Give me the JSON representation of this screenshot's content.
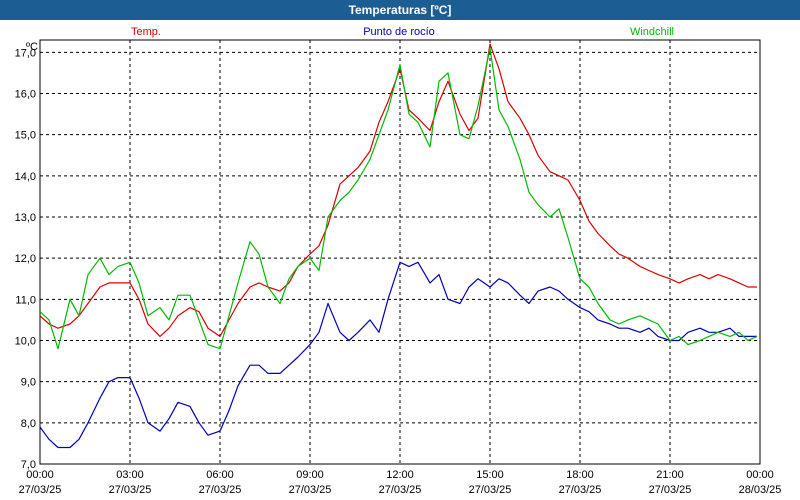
{
  "window": {
    "title": "Temperaturas [ºC]"
  },
  "chart_data": {
    "type": "line",
    "title": "Temperaturas [ºC]",
    "ylabel": "ºC",
    "ylim": [
      7.0,
      17.3
    ],
    "xlim": [
      0,
      24
    ],
    "grid": true,
    "legend_position": "top",
    "y_ticks": [
      "17,0",
      "16,0",
      "15,0",
      "14,0",
      "13,0",
      "12,0",
      "11,0",
      "10,0",
      "9,0",
      "8,0",
      "7,0"
    ],
    "y_tick_values": [
      17,
      16,
      15,
      14,
      13,
      12,
      11,
      10,
      9,
      8,
      7
    ],
    "x_ticks": [
      {
        "x": 0,
        "time": "00:00",
        "date": "27/03/25"
      },
      {
        "x": 3,
        "time": "03:00",
        "date": "27/03/25"
      },
      {
        "x": 6,
        "time": "06:00",
        "date": "27/03/25"
      },
      {
        "x": 9,
        "time": "09:00",
        "date": "27/03/25"
      },
      {
        "x": 12,
        "time": "12:00",
        "date": "27/03/25"
      },
      {
        "x": 15,
        "time": "15:00",
        "date": "27/03/25"
      },
      {
        "x": 18,
        "time": "18:00",
        "date": "27/03/25"
      },
      {
        "x": 21,
        "time": "21:00",
        "date": "27/03/25"
      },
      {
        "x": 24,
        "time": "00:00",
        "date": "28/03/25"
      }
    ],
    "series": [
      {
        "name": "Temp.",
        "color": "#dd0000",
        "x": [
          0,
          0.3,
          0.6,
          1.0,
          1.3,
          1.6,
          2.0,
          2.3,
          2.6,
          3.0,
          3.3,
          3.6,
          4.0,
          4.3,
          4.6,
          5.0,
          5.3,
          5.6,
          6.0,
          6.3,
          6.6,
          7.0,
          7.3,
          7.6,
          8.0,
          8.3,
          8.6,
          9.0,
          9.3,
          9.6,
          10.0,
          10.3,
          10.6,
          11.0,
          11.3,
          11.6,
          12.0,
          12.3,
          12.6,
          13.0,
          13.3,
          13.6,
          14.0,
          14.3,
          14.6,
          15.0,
          15.3,
          15.6,
          16.0,
          16.3,
          16.6,
          17.0,
          17.3,
          17.6,
          18.0,
          18.3,
          18.6,
          19.0,
          19.3,
          19.6,
          20.0,
          20.3,
          20.6,
          21.0,
          21.3,
          21.6,
          22.0,
          22.3,
          22.6,
          23.0,
          23.3,
          23.6,
          23.9
        ],
        "y": [
          10.6,
          10.4,
          10.3,
          10.4,
          10.6,
          10.9,
          11.3,
          11.4,
          11.4,
          11.4,
          11.0,
          10.4,
          10.1,
          10.3,
          10.6,
          10.8,
          10.7,
          10.3,
          10.1,
          10.5,
          10.9,
          11.3,
          11.4,
          11.3,
          11.2,
          11.4,
          11.8,
          12.1,
          12.3,
          12.8,
          13.8,
          14.0,
          14.2,
          14.6,
          15.3,
          15.8,
          16.6,
          15.6,
          15.4,
          15.1,
          15.8,
          16.3,
          15.5,
          15.1,
          15.4,
          17.2,
          16.6,
          15.8,
          15.4,
          15.0,
          14.5,
          14.1,
          14.0,
          13.9,
          13.4,
          12.9,
          12.6,
          12.3,
          12.1,
          12.0,
          11.8,
          11.7,
          11.6,
          11.5,
          11.4,
          11.5,
          11.6,
          11.5,
          11.6,
          11.5,
          11.4,
          11.3,
          11.3
        ]
      },
      {
        "name": "Punto de rocío",
        "color": "#0000bb",
        "x": [
          0,
          0.3,
          0.6,
          1.0,
          1.3,
          1.6,
          2.0,
          2.3,
          2.6,
          3.0,
          3.3,
          3.6,
          4.0,
          4.3,
          4.6,
          5.0,
          5.3,
          5.6,
          6.0,
          6.3,
          6.6,
          7.0,
          7.3,
          7.6,
          8.0,
          8.3,
          8.6,
          9.0,
          9.3,
          9.6,
          10.0,
          10.3,
          10.6,
          11.0,
          11.3,
          11.6,
          12.0,
          12.3,
          12.6,
          13.0,
          13.3,
          13.6,
          14.0,
          14.3,
          14.6,
          15.0,
          15.3,
          15.6,
          16.0,
          16.3,
          16.6,
          17.0,
          17.3,
          17.6,
          18.0,
          18.3,
          18.6,
          19.0,
          19.3,
          19.6,
          20.0,
          20.3,
          20.6,
          21.0,
          21.3,
          21.6,
          22.0,
          22.3,
          22.6,
          23.0,
          23.3,
          23.6,
          23.9
        ],
        "y": [
          7.9,
          7.6,
          7.4,
          7.4,
          7.6,
          8.0,
          8.6,
          9.0,
          9.1,
          9.1,
          8.6,
          8.0,
          7.8,
          8.1,
          8.5,
          8.4,
          8.0,
          7.7,
          7.8,
          8.3,
          8.9,
          9.4,
          9.4,
          9.2,
          9.2,
          9.4,
          9.6,
          9.9,
          10.2,
          10.9,
          10.2,
          10.0,
          10.2,
          10.5,
          10.2,
          11.0,
          11.9,
          11.8,
          11.9,
          11.4,
          11.6,
          11.0,
          10.9,
          11.3,
          11.5,
          11.3,
          11.5,
          11.4,
          11.1,
          10.9,
          11.2,
          11.3,
          11.2,
          11.0,
          10.8,
          10.7,
          10.5,
          10.4,
          10.3,
          10.3,
          10.2,
          10.3,
          10.1,
          10.0,
          10.0,
          10.2,
          10.3,
          10.2,
          10.2,
          10.3,
          10.1,
          10.1,
          10.1
        ]
      },
      {
        "name": "Windchill",
        "color": "#00bb00",
        "x": [
          0,
          0.3,
          0.6,
          1.0,
          1.3,
          1.6,
          2.0,
          2.3,
          2.6,
          3.0,
          3.3,
          3.6,
          4.0,
          4.3,
          4.6,
          5.0,
          5.3,
          5.6,
          6.0,
          6.3,
          6.6,
          7.0,
          7.3,
          7.6,
          8.0,
          8.3,
          8.6,
          9.0,
          9.3,
          9.6,
          10.0,
          10.3,
          10.6,
          11.0,
          11.3,
          11.6,
          12.0,
          12.3,
          12.6,
          13.0,
          13.3,
          13.6,
          14.0,
          14.3,
          14.6,
          15.0,
          15.3,
          15.6,
          16.0,
          16.3,
          16.6,
          17.0,
          17.3,
          17.6,
          18.0,
          18.3,
          18.6,
          19.0,
          19.3,
          19.6,
          20.0,
          20.3,
          20.6,
          21.0,
          21.3,
          21.6,
          22.0,
          22.3,
          22.6,
          23.0,
          23.3,
          23.6,
          23.9
        ],
        "y": [
          10.7,
          10.5,
          9.8,
          11.0,
          10.6,
          11.6,
          12.0,
          11.6,
          11.8,
          11.9,
          11.4,
          10.6,
          10.8,
          10.5,
          11.1,
          11.1,
          10.5,
          9.9,
          9.8,
          10.6,
          11.4,
          12.4,
          12.1,
          11.3,
          10.9,
          11.5,
          11.8,
          12.0,
          11.7,
          13.0,
          13.4,
          13.6,
          13.9,
          14.4,
          15.0,
          15.6,
          16.7,
          15.5,
          15.3,
          14.7,
          16.3,
          16.5,
          15.0,
          14.9,
          15.7,
          17.1,
          15.6,
          15.2,
          14.4,
          13.6,
          13.3,
          13.0,
          13.2,
          12.5,
          11.5,
          11.3,
          10.9,
          10.5,
          10.4,
          10.5,
          10.6,
          10.5,
          10.4,
          10.0,
          10.1,
          9.9,
          10.0,
          10.1,
          10.2,
          10.1,
          10.2,
          10.0,
          10.1
        ]
      }
    ]
  }
}
